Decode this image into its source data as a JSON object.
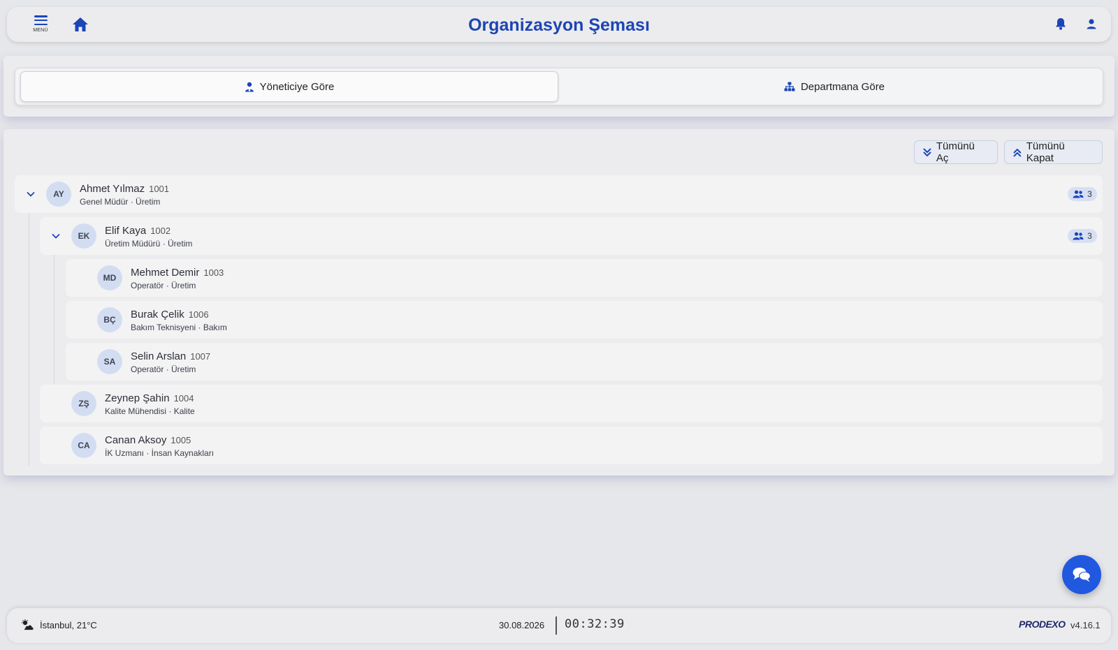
{
  "header": {
    "menu_label": "MENÜ",
    "title": "Organizasyon Şeması"
  },
  "tabs": [
    {
      "label": "Yöneticiye Göre",
      "active": true
    },
    {
      "label": "Departmana Göre",
      "active": false
    }
  ],
  "tree_actions": {
    "expand_all": "Tümünü Aç",
    "collapse_all": "Tümünü Kapat"
  },
  "nodes": [
    {
      "initials": "AY",
      "name": "Ahmet Yılmaz",
      "id": "1001",
      "role": "Genel Müdür · Üretim",
      "reports": "3",
      "expanded": true
    },
    {
      "initials": "EK",
      "name": "Elif Kaya",
      "id": "1002",
      "role": "Üretim Müdürü · Üretim",
      "reports": "3",
      "expanded": true
    },
    {
      "initials": "MD",
      "name": "Mehmet Demir",
      "id": "1003",
      "role": "Operatör · Üretim"
    },
    {
      "initials": "BÇ",
      "name": "Burak Çelik",
      "id": "1006",
      "role": "Bakım Teknisyeni · Bakım"
    },
    {
      "initials": "SA",
      "name": "Selin Arslan",
      "id": "1007",
      "role": "Operatör · Üretim"
    },
    {
      "initials": "ZŞ",
      "name": "Zeynep Şahin",
      "id": "1004",
      "role": "Kalite Mühendisi · Kalite"
    },
    {
      "initials": "CA",
      "name": "Canan Aksoy",
      "id": "1005",
      "role": "İK Uzmanı · İnsan Kaynakları"
    }
  ],
  "footer": {
    "weather": "İstanbul, 21°C",
    "date": "30.08.2026",
    "time": "00:32:39",
    "brand": "PRODEXO",
    "version": "v4.16.1"
  },
  "colors": {
    "accent": "#1d45b3",
    "fab": "#2158e0",
    "avatar_bg": "#d3ddf2"
  }
}
